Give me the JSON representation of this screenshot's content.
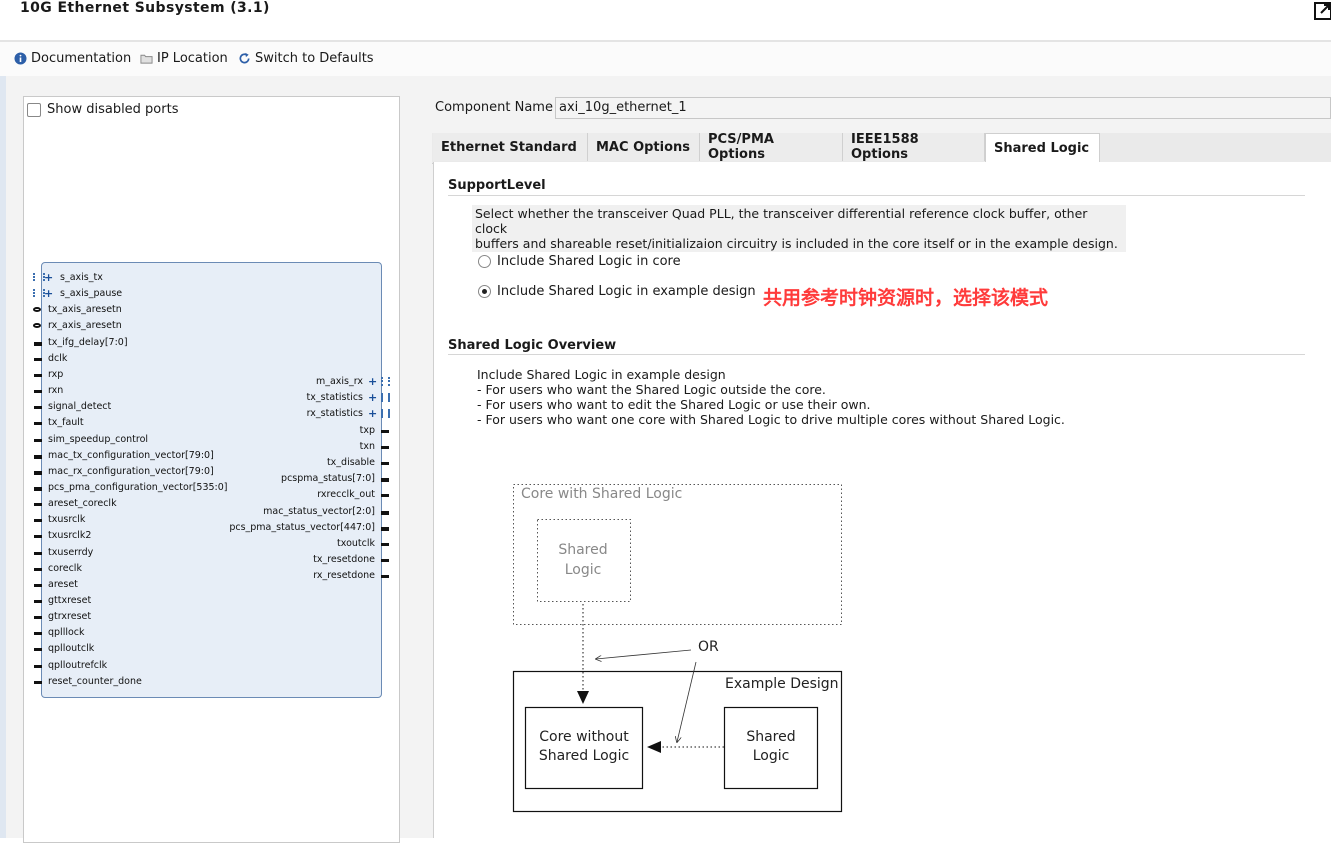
{
  "window": {
    "title": "10G Ethernet Subsystem (3.1)"
  },
  "toolbar": {
    "documentation_label": "Documentation",
    "ip_location_label": "IP Location",
    "switch_defaults_label": "Switch to Defaults"
  },
  "preview": {
    "show_disabled_label": "Show disabled ports",
    "left_ports": [
      "s_axis_tx",
      "s_axis_pause",
      "tx_axis_aresetn",
      "rx_axis_aresetn",
      "tx_ifg_delay[7:0]",
      "dclk",
      "rxp",
      "rxn",
      "signal_detect",
      "tx_fault",
      "sim_speedup_control",
      "mac_tx_configuration_vector[79:0]",
      "mac_rx_configuration_vector[79:0]",
      "pcs_pma_configuration_vector[535:0]",
      "areset_coreclk",
      "txusrclk",
      "txusrclk2",
      "txuserrdy",
      "coreclk",
      "areset",
      "gttxreset",
      "gtrxreset",
      "qplllock",
      "qplloutclk",
      "qplloutrefclk",
      "reset_counter_done"
    ],
    "right_ports": [
      "m_axis_rx",
      "tx_statistics",
      "rx_statistics",
      "txp",
      "txn",
      "tx_disable",
      "pcspma_status[7:0]",
      "rxrecclk_out",
      "mac_status_vector[2:0]",
      "pcs_pma_status_vector[447:0]",
      "txoutclk",
      "tx_resetdone",
      "rx_resetdone"
    ]
  },
  "config": {
    "component_name_label": "Component Name",
    "component_name_value": "axi_10g_ethernet_1",
    "tabs": [
      {
        "label": "Ethernet Standard"
      },
      {
        "label": "MAC Options"
      },
      {
        "label": "PCS/PMA Options"
      },
      {
        "label": "IEEE1588 Options"
      },
      {
        "label": "Shared Logic"
      }
    ],
    "active_tab": "Shared Logic",
    "support_level": {
      "title": "SupportLevel",
      "description_line1": "Select whether the transceiver Quad PLL, the transceiver differential reference clock buffer, other clock",
      "description_line2": "buffers and shareable reset/initializaion circuitry is included in the core itself or in the example design.",
      "options": [
        {
          "label": "Include Shared Logic in core",
          "selected": false
        },
        {
          "label": "Include Shared Logic in example design",
          "selected": true
        }
      ]
    },
    "annotation": "共用参考时钟资源时，选择该模式",
    "overview": {
      "title": "Shared Logic Overview",
      "lines": [
        "Include Shared Logic in example design",
        "- For users who want the Shared Logic outside the core.",
        "- For users who want to edit the Shared Logic or use their own.",
        "- For users who want one core with Shared Logic to drive multiple cores without Shared Logic."
      ]
    },
    "diagram": {
      "core_with_label": "Core with Shared Logic",
      "shared_logic_grey": "Shared Logic",
      "or_label": "OR",
      "example_design_label": "Example Design",
      "core_without_label": "Core without Shared Logic",
      "shared_logic_label": "Shared Logic"
    }
  }
}
